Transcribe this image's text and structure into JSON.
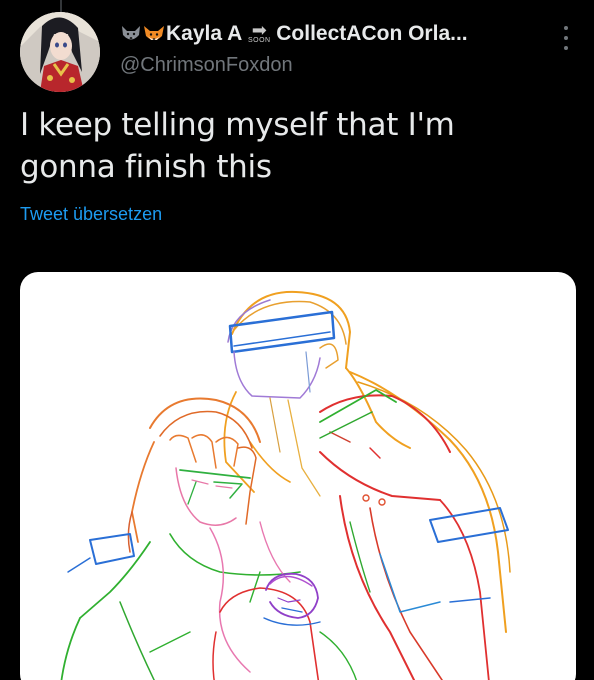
{
  "author": {
    "display_name": "Kayla A",
    "display_name_rest": "CollectACon Orla...",
    "soon_label": "SOON",
    "handle": "@ChrimsonFoxdon",
    "name_emojis": [
      "wolf-emoji",
      "fox-emoji"
    ]
  },
  "tweet": {
    "text_line_1": "I keep telling myself that I'm",
    "text_line_2": "gonna finish this",
    "translate_label": "Tweet übersetzen"
  },
  "colors": {
    "background": "#000000",
    "text": "#e7e9ea",
    "secondary": "#71767b",
    "link": "#1d9bf0",
    "media_bg": "#ffffff"
  },
  "icons": {
    "more": "more-vertical-icon",
    "arrow": "arrow-right-icon"
  }
}
